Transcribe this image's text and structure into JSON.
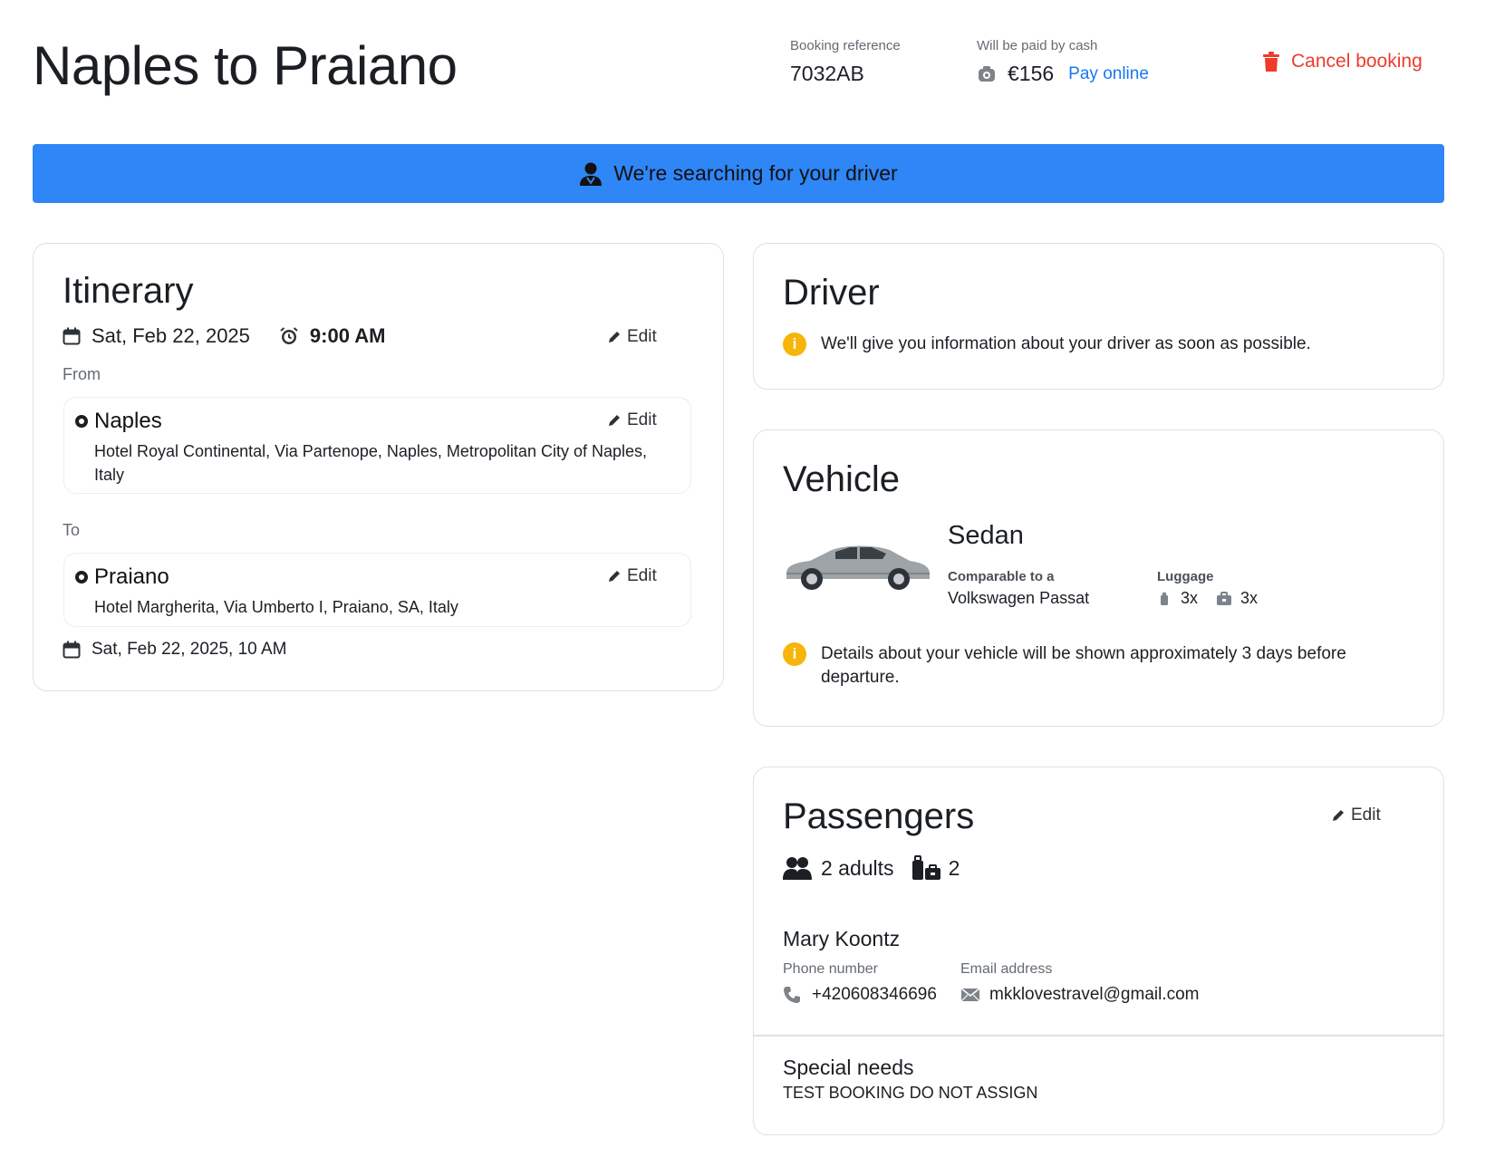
{
  "header": {
    "title": "Naples to Praiano",
    "booking_ref_label": "Booking reference",
    "booking_ref": "7032AB",
    "payment_label": "Will be paid by cash",
    "price": "€156",
    "pay_online": "Pay online",
    "cancel": "Cancel booking"
  },
  "banner": {
    "text": "We're searching for your driver"
  },
  "itinerary": {
    "title": "Itinerary",
    "date": "Sat, Feb 22, 2025",
    "time": "9:00 AM",
    "edit": "Edit",
    "from_label": "From",
    "from": {
      "name": "Naples",
      "address": "Hotel Royal Continental, Via Partenope, Naples, Metropolitan City of Naples, Italy",
      "edit": "Edit"
    },
    "to_label": "To",
    "to": {
      "name": "Praiano",
      "address": "Hotel Margherita, Via Umberto I, Praiano, SA, Italy",
      "edit": "Edit"
    },
    "arrival": "Sat, Feb 22, 2025, 10 AM"
  },
  "driver": {
    "title": "Driver",
    "info": "We'll give you information about your driver as soon as possible."
  },
  "vehicle": {
    "title": "Vehicle",
    "type": "Sedan",
    "comparable_label": "Comparable to a",
    "comparable": "Volkswagen Passat",
    "luggage_label": "Luggage",
    "luggage_small": "3x",
    "luggage_large": "3x",
    "info": "Details about your vehicle will be shown approximately 3 days before departure."
  },
  "passengers": {
    "title": "Passengers",
    "edit": "Edit",
    "adults": "2 adults",
    "bags": "2",
    "name": "Mary Koontz",
    "phone_label": "Phone number",
    "phone": "+420608346696",
    "email_label": "Email address",
    "email": "mkklovestravel@gmail.com",
    "special_needs_label": "Special needs",
    "special_needs": "TEST BOOKING DO NOT ASSIGN"
  },
  "colors": {
    "accent_blue": "#2f86f6",
    "link_blue": "#1877f2",
    "danger_red": "#ee3b2b",
    "info_yellow": "#f7b50a"
  }
}
